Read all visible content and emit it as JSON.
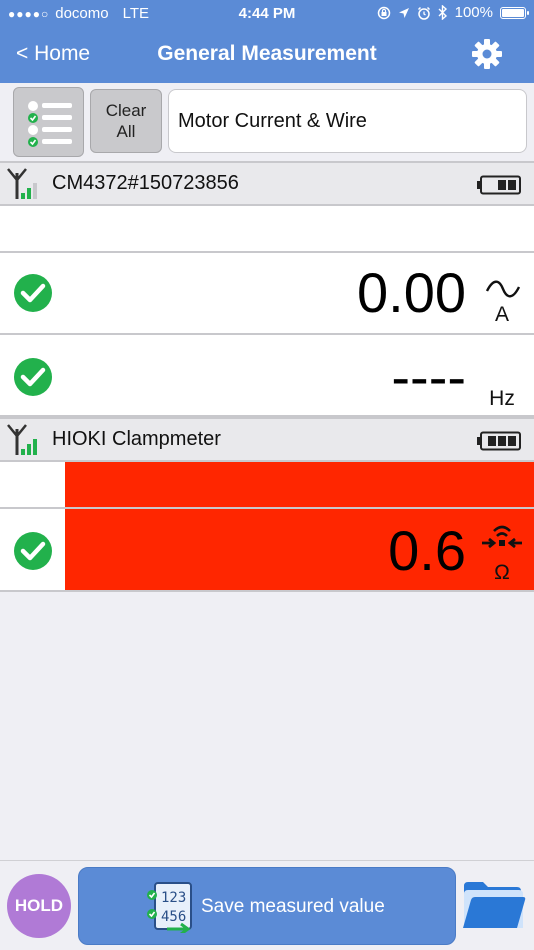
{
  "status": {
    "carrier": "docomo",
    "network": "LTE",
    "time": "4:44 PM",
    "battery": "100%"
  },
  "nav": {
    "back_label": "< Home",
    "title": "General Measurement"
  },
  "toolbar": {
    "clear_line1": "Clear",
    "clear_line2": "All",
    "measurement_name": "Motor Current & Wire"
  },
  "devices": [
    {
      "name": "CM4372#150723856",
      "readings": [
        {
          "value": "0.00",
          "unit": "A",
          "mode": "AC"
        },
        {
          "value": "----",
          "unit": "Hz"
        }
      ]
    },
    {
      "name": "HIOKI Clampmeter",
      "readings": [
        {
          "value": "0.6",
          "unit": "Ω",
          "mode": "continuity"
        }
      ]
    }
  ],
  "footer": {
    "hold_label": "HOLD",
    "save_label": "Save measured value",
    "save_icon_digits_top": "123",
    "save_icon_digits_bottom": "456"
  },
  "colors": {
    "nav_blue": "#5b8bd6",
    "alert_red": "#ff2600",
    "check_green": "#22b14c",
    "hold_purple": "#b07ad6"
  }
}
